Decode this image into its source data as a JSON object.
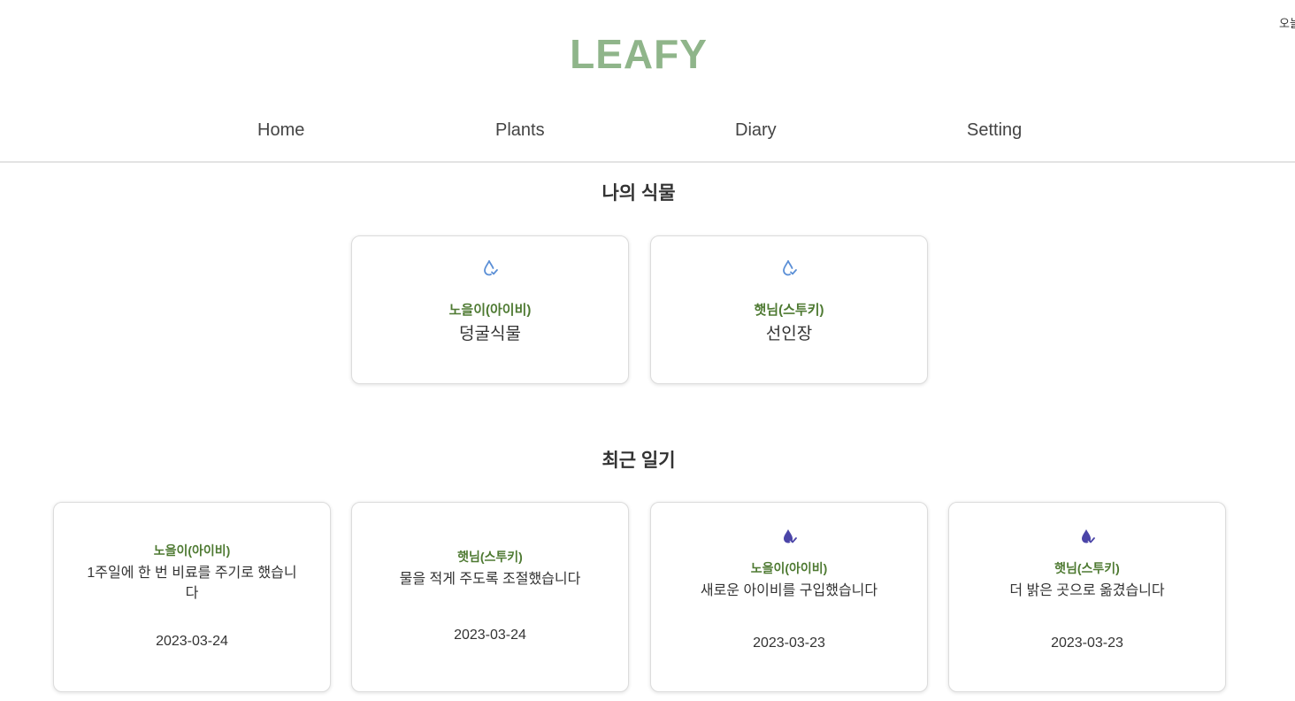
{
  "header": {
    "corner_text": "오늘",
    "logo": "LEAFY"
  },
  "nav": {
    "items": [
      {
        "label": "Home"
      },
      {
        "label": "Plants"
      },
      {
        "label": "Diary"
      },
      {
        "label": "Setting"
      }
    ]
  },
  "plants_section": {
    "title": "나의 식물",
    "cards": [
      {
        "icon": "water-drop-check-outline-icon",
        "name": "노을이(아이비)",
        "type": "덩굴식물"
      },
      {
        "icon": "water-drop-check-outline-icon",
        "name": "햇님(스투키)",
        "type": "선인장"
      }
    ]
  },
  "diary_section": {
    "title": "최근 일기",
    "cards": [
      {
        "icon": "",
        "name": "노을이(아이비)",
        "text": "1주일에 한 번 비료를 주기로 했습니다",
        "date": "2023-03-24"
      },
      {
        "icon": "",
        "name": "햇님(스투키)",
        "text": "물을 적게 주도록 조절했습니다",
        "date": "2023-03-24"
      },
      {
        "icon": "water-drop-check-filled-icon",
        "name": "노을이(아이비)",
        "text": "새로운 아이비를 구입했습니다",
        "date": "2023-03-23"
      },
      {
        "icon": "water-drop-check-filled-icon",
        "name": "햇님(스투키)",
        "text": "더 밝은 곳으로 옮겼습니다",
        "date": "2023-03-23"
      }
    ]
  },
  "colors": {
    "logo": "#8fb58a",
    "plant_name": "#4e7a32",
    "outline_drop": "#5b8fd6",
    "filled_drop": "#4b45a8"
  }
}
